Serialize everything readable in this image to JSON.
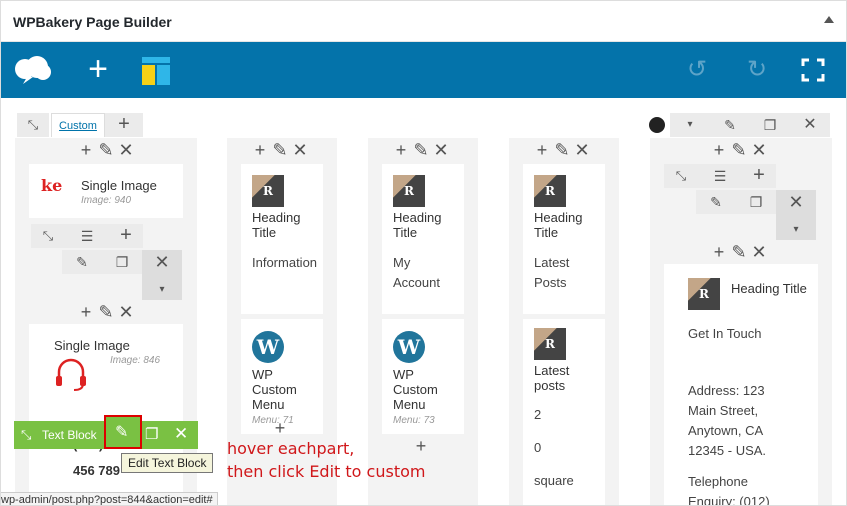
{
  "panel": {
    "title": "WPBakery Page Builder"
  },
  "toolbar": {
    "icons": [
      "cloud-icon",
      "plus-icon",
      "layout-icon",
      "undo-icon",
      "redo-icon",
      "fullscreen-icon"
    ]
  },
  "row1": {
    "tab_label": "Custom"
  },
  "col1": {
    "el1_title": "Single Image",
    "el1_sub": "Image: 940",
    "el2_title": "Single Image",
    "el2_sub": "Image: 846",
    "partial_text": "(012) 345",
    "partial_text2": "456 789"
  },
  "col2": {
    "el1_title": "Heading Title",
    "el1_text": "Information",
    "el2_title": "WP Custom Menu",
    "el2_sub": "Menu: 71"
  },
  "col3": {
    "el1_title": "Heading Title",
    "el1_text": "My Account",
    "el2_title": "WP Custom Menu",
    "el2_sub": "Menu: 73"
  },
  "col4": {
    "el1_title": "Heading Title",
    "el1_text": "Latest Posts",
    "el2_title": "Latest posts",
    "el2_v1": "2",
    "el2_v2": "0",
    "el2_v3": "square"
  },
  "col5": {
    "el_title": "Heading Title",
    "text1": "Get In Touch",
    "text2": "Address: 123 Main Street, Anytown, CA 12345 - USA.",
    "text3": "Telephone Enquiry: (012)"
  },
  "greenbar": {
    "label": "Text Block"
  },
  "tooltip": "Edit Text Block",
  "annotation": {
    "line1": "hover eachpart,",
    "line2": "then click Edit to custom"
  },
  "status_url": "wp-admin/post.php?post=844&action=edit#",
  "colors": {
    "brand": "#0473aa",
    "green": "#7ac143",
    "annotation": "#d0171a"
  }
}
